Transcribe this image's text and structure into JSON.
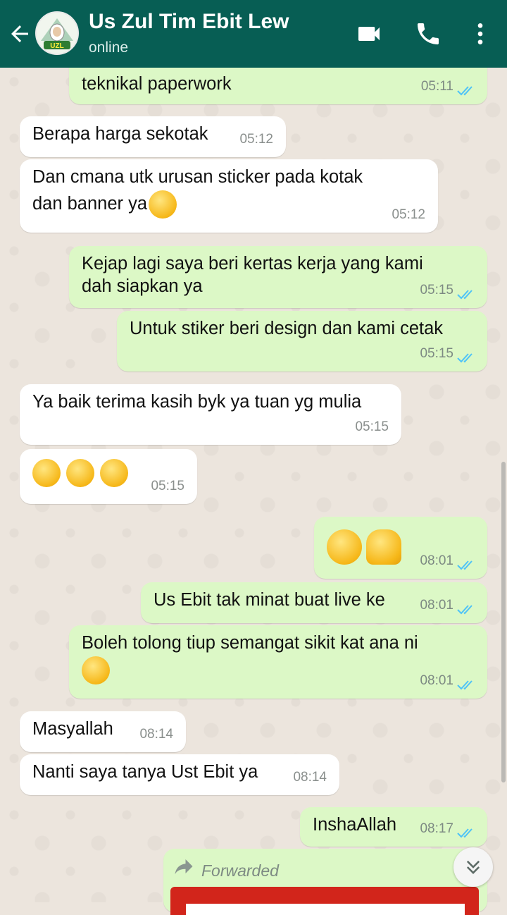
{
  "header": {
    "contact_name": "Us Zul Tim Ebit Lew",
    "status": "online",
    "avatar_label": "UZL",
    "colors": {
      "bar": "#075e54",
      "text": "#ffffff"
    },
    "icons": [
      "back-arrow-icon",
      "video-call-icon",
      "phone-icon",
      "more-options-icon"
    ]
  },
  "messages": [
    {
      "dir": "out",
      "text": "teknikal paperwork",
      "time": "05:11",
      "read": true
    },
    {
      "dir": "in",
      "text": "Berapa harga sekotak",
      "time": "05:12"
    },
    {
      "dir": "in",
      "line1": "Dan cmana utk urusan sticker pada kotak",
      "line2": "dan banner ya",
      "emoji": "😊",
      "time": "05:12"
    },
    {
      "dir": "out",
      "line1": "Kejap lagi saya beri kertas kerja yang kami",
      "line2": "dah siapkan ya",
      "time": "05:15",
      "read": true
    },
    {
      "dir": "out",
      "text": "Untuk stiker beri design dan kami cetak",
      "time": "05:15",
      "read": true
    },
    {
      "dir": "in",
      "text": "Ya baik terima kasih byk ya tuan yg mulia",
      "time": "05:15"
    },
    {
      "dir": "in",
      "emoji": "😊😊😊",
      "time": "05:15"
    },
    {
      "dir": "out",
      "emoji": "😃🙌",
      "time": "08:01",
      "read": true
    },
    {
      "dir": "out",
      "text": "Us Ebit tak minat buat live ke",
      "time": "08:01",
      "read": true
    },
    {
      "dir": "out",
      "text": "Boleh tolong tiup semangat sikit kat ana ni",
      "emoji": "😄",
      "time": "08:01",
      "read": true
    },
    {
      "dir": "in",
      "text": "Masyallah",
      "time": "08:14"
    },
    {
      "dir": "in",
      "text": "Nanti saya tanya Ust Ebit ya",
      "time": "08:14"
    },
    {
      "dir": "out",
      "text": "InshaAllah",
      "time": "08:17",
      "read": true
    },
    {
      "dir": "out",
      "forwarded_label": "Forwarded",
      "icon": "forward-arrow-icon"
    }
  ],
  "colors": {
    "chat_background": "#ece5dd",
    "incoming_bubble": "#ffffff",
    "outgoing_bubble": "#dcf8c6",
    "read_tick": "#4fc3f7"
  },
  "scroll_button": {
    "icon": "double-chevron-down-icon"
  }
}
